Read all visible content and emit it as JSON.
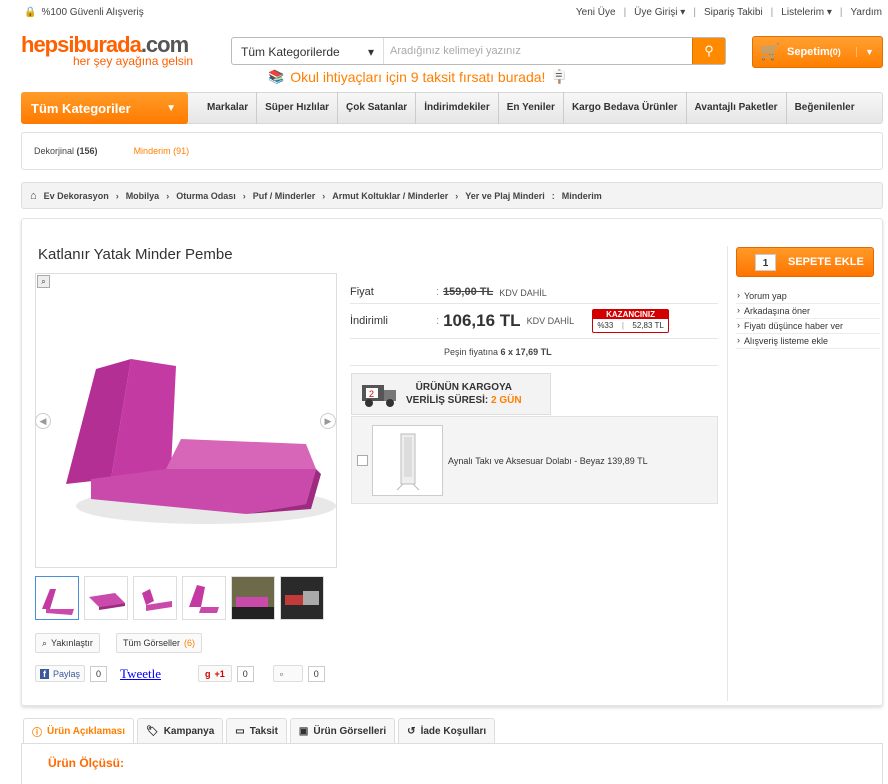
{
  "topbar": {
    "secure_text": "%100 Güvenli Alışveriş",
    "links": [
      "Yeni Üye",
      "Üye Girişi",
      "Sipariş Takibi",
      "Listelerim",
      "Yardım"
    ]
  },
  "logo": {
    "main_a": "hepsiburada",
    "main_b": ".com",
    "slogan": "her şey ayağına gelsin"
  },
  "search": {
    "category": "Tüm Kategorilerde",
    "placeholder": "Aradığınız kelimeyi yazınız"
  },
  "cart": {
    "label": "Sepetim",
    "count": "(0)"
  },
  "promo": {
    "text": "Okul ihtiyaçları için 9 taksit fırsatı burada!"
  },
  "nav": {
    "all_categories": "Tüm Kategoriler",
    "items": [
      "Markalar",
      "Süper Hızlılar",
      "Çok Satanlar",
      "İndirimdekiler",
      "En Yeniler",
      "Kargo Bedava Ürünler",
      "Avantajlı Paketler",
      "Beğenilenler"
    ]
  },
  "filters": [
    {
      "label": "Dekorjinal",
      "count": "(156)"
    },
    {
      "label": "Minderim",
      "count": "(91)"
    }
  ],
  "breadcrumb": [
    "Ev Dekorasyon",
    "Mobilya",
    "Oturma Odası",
    "Puf / Minderler",
    "Armut Koltuklar / Minderler",
    "Yer ve Plaj Minderi",
    "Minderim"
  ],
  "product": {
    "title": "Katlanır Yatak Minder Pembe",
    "price_label": "Fiyat",
    "old_price": "159,00 TL",
    "kdv_text": "KDV DAHİL",
    "discount_label": "İndirimli",
    "new_price": "106,16 TL",
    "kdv_text2": "KDV DAHİL",
    "kazanc_title": "KAZANCINIZ",
    "kazanc_percent": "%33",
    "kazanc_amount": "52,83 TL",
    "installment": "Peşin fiyatına",
    "installment_value": "6 x 17,69 TL",
    "zoom_label": "Yakınlaştır",
    "all_images_label": "Tüm Görseller",
    "all_images_count": "(6)"
  },
  "cargo": {
    "line1": "ÜRÜNÜN KARGOYA",
    "line2": "VERİLİŞ SÜRESİ:",
    "days": "2",
    "unit": "GÜN",
    "badge": "2"
  },
  "accessory": {
    "text": "Aynalı Takı ve Aksesuar Dolabı - Beyaz 139,89 TL"
  },
  "social": {
    "facebook": "Paylaş",
    "fb_count": "0",
    "tweet": "Tweetle",
    "gplus": "+1",
    "gplus_count": "0",
    "other_count": "0"
  },
  "sidebar": {
    "add_to_cart": "SEPETE EKLE",
    "qty": "1",
    "links": [
      "Yorum yap",
      "Arkadaşına öner",
      "Fiyatı düşünce haber ver",
      "Alışveriş listeme ekle"
    ]
  },
  "tabs": [
    "Ürün Açıklaması",
    "Kampanya",
    "Taksit",
    "Ürün Görselleri",
    "İade Koşulları"
  ],
  "details": {
    "heading": "Ürün Ölçüsü:"
  },
  "colors": {
    "brand": "#ff7f00",
    "product": "#c2379e"
  }
}
